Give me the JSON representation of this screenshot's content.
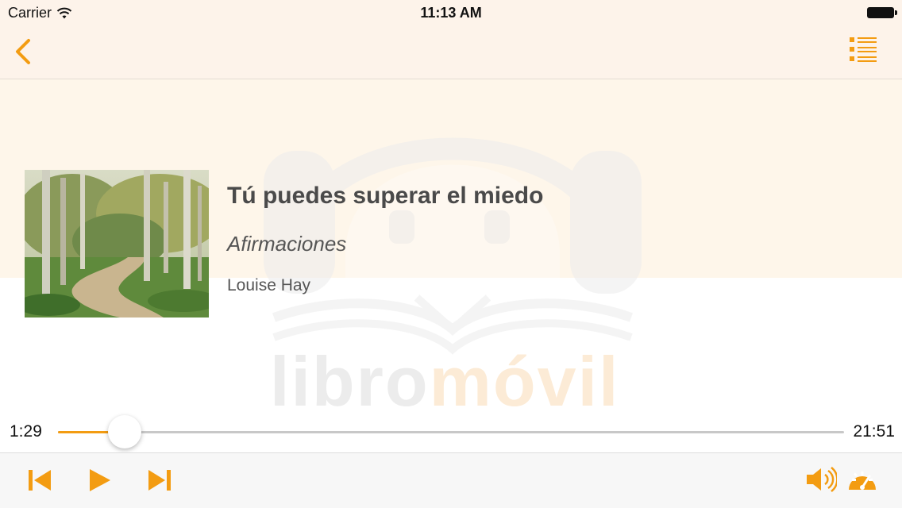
{
  "status_bar": {
    "carrier": "Carrier",
    "time": "11:13 AM"
  },
  "watermark": {
    "text_part1": "libro",
    "text_part2": "móvil"
  },
  "book": {
    "title": "Tú puedes superar el miedo",
    "subtitle": "Afirmaciones",
    "author": "Louise Hay"
  },
  "player": {
    "elapsed": "1:29",
    "total": "21:51",
    "progress_fraction": 0.085
  },
  "colors": {
    "accent": "#f39c12",
    "nav_background": "#fdf3ea"
  },
  "icons": {
    "back": "chevron-left-icon",
    "chapters": "list-icon",
    "previous": "skip-back-icon",
    "play": "play-icon",
    "next": "skip-forward-icon",
    "volume": "speaker-icon",
    "speed": "speedometer-icon"
  }
}
